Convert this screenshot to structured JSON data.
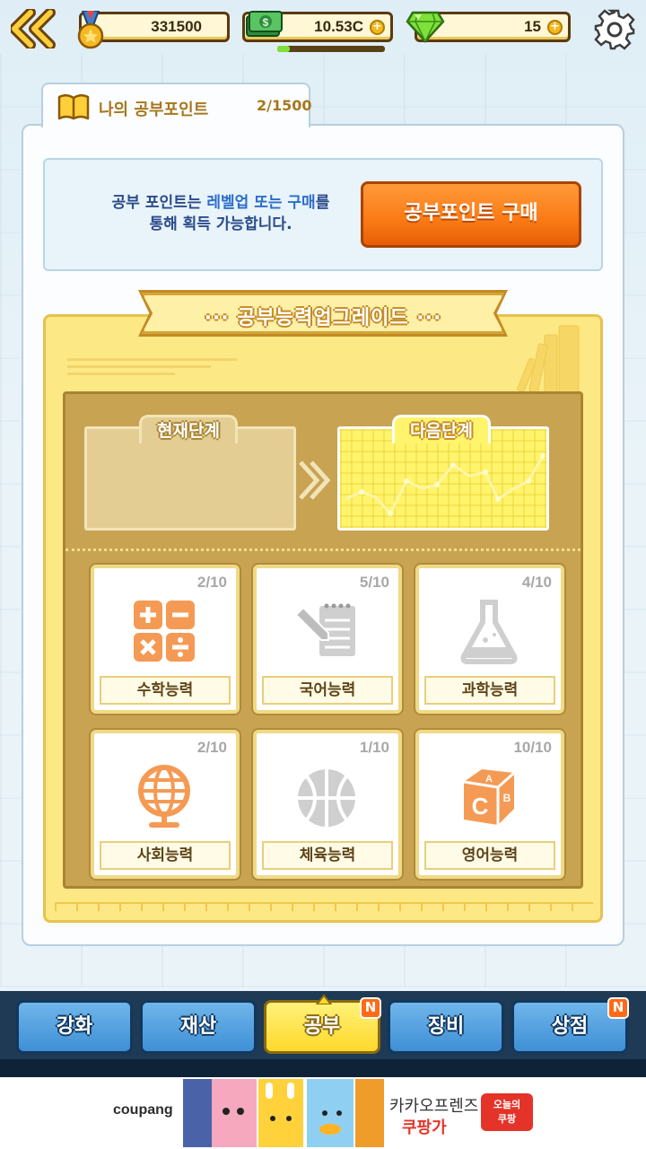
{
  "topbar": {
    "medal_points": "331500",
    "cash": "10.53C",
    "gems": "15",
    "cash_bar_fill": 0.12
  },
  "study_points": {
    "title": "나의 공부포인트",
    "count": "2/1500",
    "info_line1_a": "공부 포인트는 ",
    "info_line1_b": "레벨업 또는 구매",
    "info_line1_c": "를",
    "info_line2": "통해 획득 가능합니다.",
    "buy_button": "공부포인트 구매"
  },
  "upgrade": {
    "ribbon_title": "··· 공부능력업그레이드 ···",
    "current_stage": "현재단계",
    "next_stage": "다음단계",
    "abilities": [
      {
        "label": "수학능력",
        "count": "2/10",
        "icon": "calculator-icon",
        "active": true
      },
      {
        "label": "국어능력",
        "count": "5/10",
        "icon": "notepad-pencil-icon",
        "active": false
      },
      {
        "label": "과학능력",
        "count": "4/10",
        "icon": "flask-icon",
        "active": false
      },
      {
        "label": "사회능력",
        "count": "2/10",
        "icon": "globe-icon",
        "active": true
      },
      {
        "label": "체육능력",
        "count": "1/10",
        "icon": "basketball-icon",
        "active": false
      },
      {
        "label": "영어능력",
        "count": "10/10",
        "icon": "abc-block-icon",
        "active": true
      }
    ]
  },
  "nav": {
    "tabs": [
      {
        "label": "강화",
        "badge": ""
      },
      {
        "label": "재산",
        "badge": ""
      },
      {
        "label": "공부",
        "badge": "N"
      },
      {
        "label": "장비",
        "badge": ""
      },
      {
        "label": "상점",
        "badge": "N"
      }
    ],
    "active_index": 2
  },
  "ad": {
    "brand": "coupang",
    "line1": "카카오프렌즈",
    "line2": "쿠팡가",
    "coupon_line1": "오늘의",
    "coupon_line2": "쿠팡"
  },
  "colors": {
    "accent_orange": "#fb7a14",
    "panel_yellow": "#fde886",
    "nav_blue": "#3f8fd6",
    "nav_active": "#ffd82b",
    "icon_orange": "#f59a54",
    "icon_gray": "#cfcfcf"
  }
}
